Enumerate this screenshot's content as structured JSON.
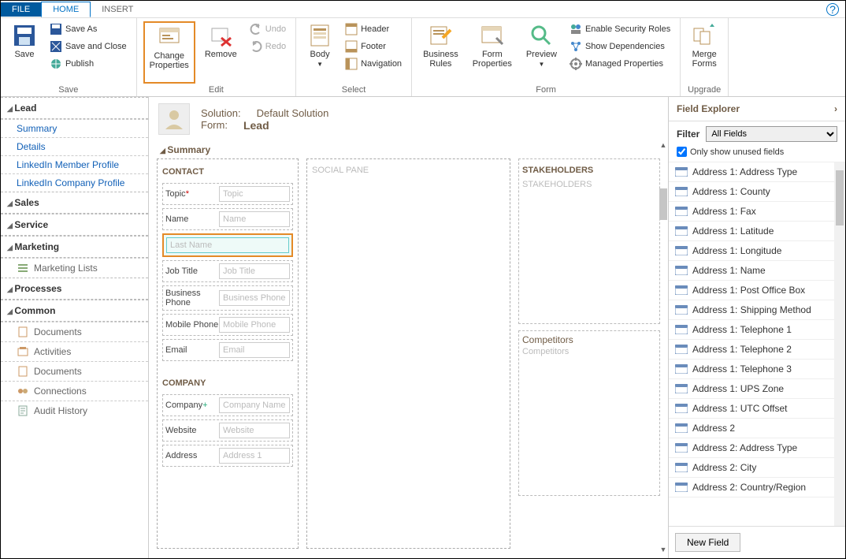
{
  "tabs": {
    "file": "FILE",
    "home": "HOME",
    "insert": "INSERT"
  },
  "ribbon": {
    "save": "Save",
    "saveas": "Save As",
    "saveclose": "Save and Close",
    "publish": "Publish",
    "changeprops": "Change\nProperties",
    "remove": "Remove",
    "undo": "Undo",
    "redo": "Redo",
    "body": "Body",
    "header": "Header",
    "footer": "Footer",
    "navigation": "Navigation",
    "bizrules": "Business\nRules",
    "formprops": "Form\nProperties",
    "preview": "Preview",
    "security": "Enable Security Roles",
    "deps": "Show Dependencies",
    "managed": "Managed Properties",
    "merge": "Merge\nForms",
    "groups": {
      "save": "Save",
      "edit": "Edit",
      "select": "Select",
      "form": "Form",
      "upgrade": "Upgrade"
    }
  },
  "leftnav": {
    "lead": "Lead",
    "lead_items": [
      "Summary",
      "Details",
      "LinkedIn Member Profile",
      "LinkedIn Company Profile"
    ],
    "sales": "Sales",
    "service": "Service",
    "marketing": "Marketing",
    "marketing_items": [
      "Marketing Lists"
    ],
    "processes": "Processes",
    "common": "Common",
    "common_items": [
      "Documents",
      "Activities",
      "Documents",
      "Connections",
      "Audit History"
    ]
  },
  "canvas": {
    "solution_lbl": "Solution:",
    "solution_val": "Default Solution",
    "form_lbl": "Form:",
    "form_val": "Lead",
    "summary": "Summary",
    "contact": "CONTACT",
    "company": "COMPANY",
    "social": "SOCIAL PANE",
    "stakeholders": "STAKEHOLDERS",
    "stakeholders_ph": "STAKEHOLDERS",
    "competitors": "Competitors",
    "competitors_ph": "Competitors",
    "fields": {
      "topic": {
        "l": "Topic",
        "p": "Topic",
        "req": true
      },
      "name": {
        "l": "Name",
        "p": "Name"
      },
      "lastname": {
        "l": "",
        "p": "Last Name",
        "sel": true
      },
      "jobtitle": {
        "l": "Job Title",
        "p": "Job Title"
      },
      "bphone": {
        "l": "Business Phone",
        "p": "Business Phone"
      },
      "mphone": {
        "l": "Mobile Phone",
        "p": "Mobile Phone"
      },
      "email": {
        "l": "Email",
        "p": "Email"
      },
      "company": {
        "l": "Company",
        "p": "Company Name",
        "plus": true
      },
      "website": {
        "l": "Website",
        "p": "Website"
      },
      "address": {
        "l": "Address",
        "p": "Address 1"
      }
    }
  },
  "explorer": {
    "title": "Field Explorer",
    "filter_lbl": "Filter",
    "filter_val": "All Fields",
    "unused_chk": "Only show unused fields",
    "items": [
      "Address 1: Address Type",
      "Address 1: County",
      "Address 1: Fax",
      "Address 1: Latitude",
      "Address 1: Longitude",
      "Address 1: Name",
      "Address 1: Post Office Box",
      "Address 1: Shipping Method",
      "Address 1: Telephone 1",
      "Address 1: Telephone 2",
      "Address 1: Telephone 3",
      "Address 1: UPS Zone",
      "Address 1: UTC Offset",
      "Address 2",
      "Address 2: Address Type",
      "Address 2: City",
      "Address 2: Country/Region"
    ],
    "newfield": "New Field"
  }
}
